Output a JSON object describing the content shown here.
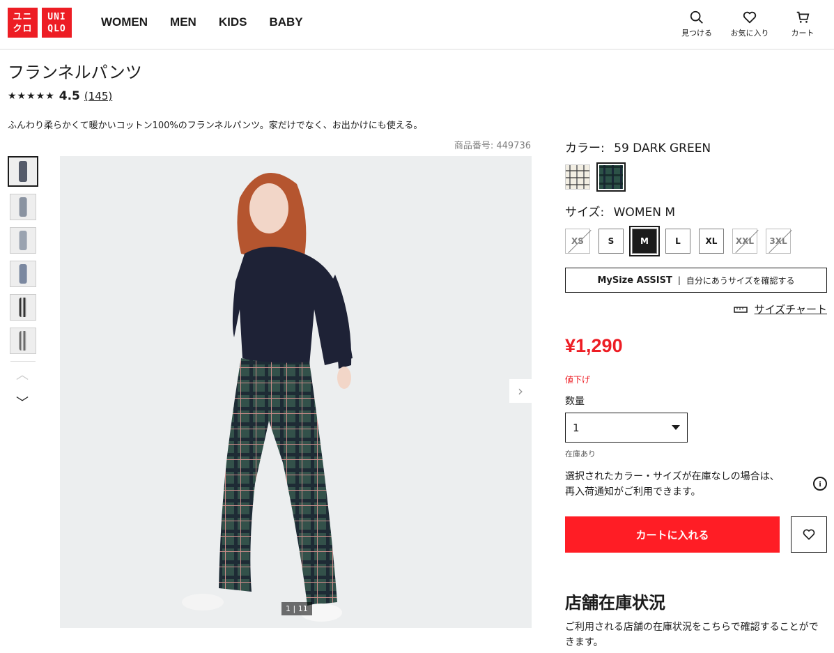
{
  "header": {
    "logo": {
      "top": "ユニクロ",
      "bottom": "UNIQLO",
      "color": "#ed1d24"
    },
    "nav": [
      "WOMEN",
      "MEN",
      "KIDS",
      "BABY"
    ],
    "icons": [
      {
        "icon": "search-icon",
        "label": "見つける"
      },
      {
        "icon": "heart-icon",
        "label": "お気に入り"
      },
      {
        "icon": "cart-icon",
        "label": "カート"
      }
    ]
  },
  "product": {
    "title": "フランネルパンツ",
    "stars": "★★★★★",
    "rating": "4.5",
    "review_count": "(145)",
    "description": "ふんわり柔らかくて暖かいコットン100%のフランネルパンツ。家だけでなく、お出かけにも使える。",
    "product_number": "商品番号: 449736",
    "image_counter": "1 | 11"
  },
  "options": {
    "color_label": "カラー:",
    "color_value": "59 DARK GREEN",
    "size_label": "サイズ:",
    "size_value": "WOMEN M",
    "sizes": [
      {
        "label": "XS",
        "available": false
      },
      {
        "label": "S",
        "available": true
      },
      {
        "label": "M",
        "available": true,
        "selected": true
      },
      {
        "label": "L",
        "available": true
      },
      {
        "label": "XL",
        "available": true
      },
      {
        "label": "XXL",
        "available": false
      },
      {
        "label": "3XL",
        "available": false
      }
    ],
    "mysize_title": "MySize ASSIST",
    "mysize_text": "自分にあうサイズを確認する",
    "size_chart": "サイズチャート"
  },
  "purchase": {
    "price": "¥1,290",
    "price_color": "#ed1d24",
    "sale_tag": "値下げ",
    "quantity_label": "数量",
    "quantity_value": "1",
    "stock_status": "在庫あり",
    "notify_line1": "選択されたカラー・サイズが在庫なしの場合は、",
    "notify_line2": "再入荷通知がご利用できます。",
    "add_to_cart": "カートに入れる"
  },
  "store": {
    "title": "店舗在庫状況",
    "text": "ご利用される店舗の在庫状況をこちらで確認することができます。"
  }
}
